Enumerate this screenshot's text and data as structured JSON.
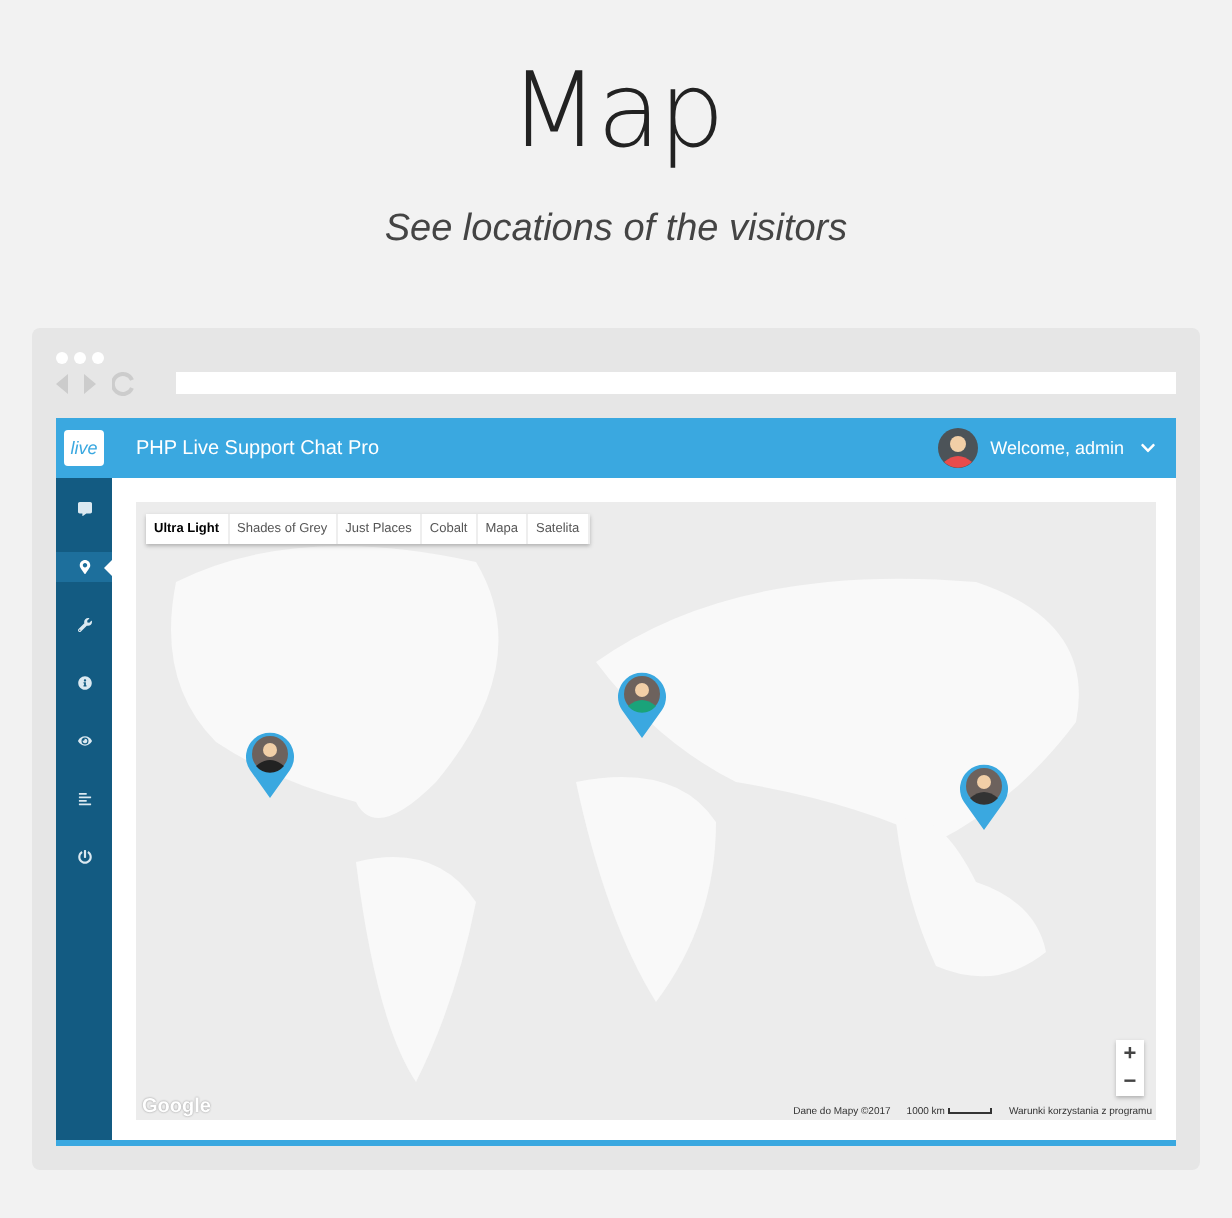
{
  "heading": "Map",
  "subtitle": "See locations of the visitors",
  "app": {
    "title": "PHP Live Support Chat Pro",
    "logo": "live",
    "user": "Welcome, admin"
  },
  "sidebar": {
    "items": [
      {
        "kind": "chat",
        "selected": false
      },
      {
        "kind": "pin",
        "selected": true
      },
      {
        "kind": "wrench",
        "selected": false
      },
      {
        "kind": "info",
        "selected": false
      },
      {
        "kind": "eye",
        "selected": false
      },
      {
        "kind": "report",
        "selected": false
      },
      {
        "kind": "power",
        "selected": false
      }
    ]
  },
  "map": {
    "styles": [
      {
        "label": "Ultra Light",
        "selected": true
      },
      {
        "label": "Shades of Grey",
        "selected": false
      },
      {
        "label": "Just Places",
        "selected": false
      },
      {
        "label": "Cobalt",
        "selected": false
      },
      {
        "label": "Mapa",
        "selected": false
      },
      {
        "label": "Satelita",
        "selected": false
      }
    ],
    "zoom_in": "+",
    "zoom_out": "−",
    "logo": "Google",
    "attribution": "Dane do Mapy ©2017",
    "scale": "1000 km",
    "terms": "Warunki korzystania z programu"
  }
}
